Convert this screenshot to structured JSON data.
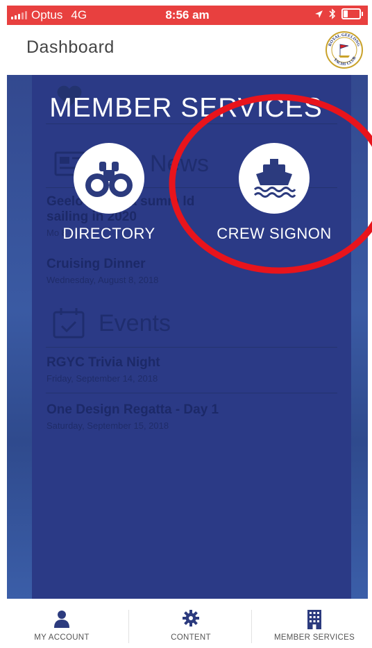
{
  "status": {
    "carrier": "Optus",
    "network": "4G",
    "time": "8:56 am"
  },
  "header": {
    "title": "Dashboard",
    "logo_text_top": "ROYAL GEELONG",
    "logo_text_bottom": "YACHT CLUB"
  },
  "background": {
    "news_heading": "News",
    "news_items": [
      {
        "title": "Geelong to sail for a summer world sailing in 2020",
        "title_line1": "Geelo     sail  or a summ     ld",
        "title_line2": "sailing in 2020",
        "date": "Mo                     8"
      },
      {
        "title": "Cruising Dinner",
        "date": "Wednesday, August 8, 2018"
      }
    ],
    "events_heading": "Events",
    "event_items": [
      {
        "title": "RGYC Trivia Night",
        "date": "Friday, September 14, 2018"
      },
      {
        "title": "One Design Regatta - Day 1",
        "date": "Saturday, September 15, 2018"
      }
    ]
  },
  "overlay": {
    "title": "MEMBER SERVICES",
    "buttons": [
      {
        "label": "DIRECTORY",
        "icon": "binoculars-icon"
      },
      {
        "label": "CREW SIGNON",
        "icon": "ship-icon"
      }
    ]
  },
  "tabs": [
    {
      "label": "MY ACCOUNT",
      "icon": "user-icon"
    },
    {
      "label": "CONTENT",
      "icon": "gear-icon"
    },
    {
      "label": "MEMBER SERVICES",
      "icon": "building-icon"
    }
  ],
  "colors": {
    "status_bar": "#e8403f",
    "overlay_bg": "#2b3a86",
    "highlight_ring": "#e8141c",
    "icon_navy": "#2c3b7e"
  }
}
